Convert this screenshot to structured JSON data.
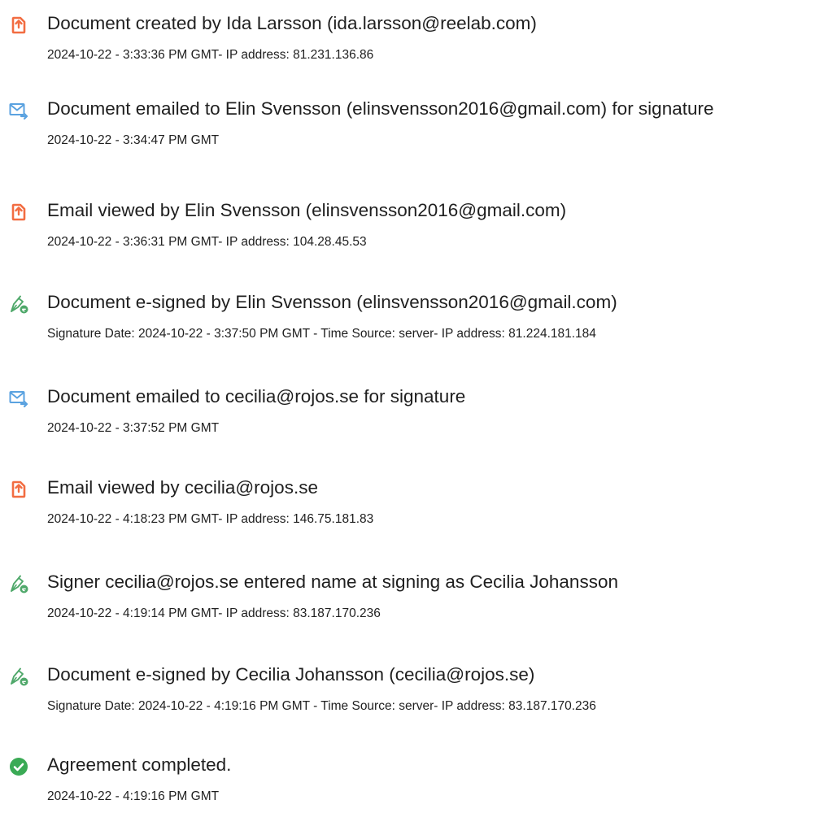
{
  "events": [
    {
      "icon": "document-created-icon",
      "title": "Document created by Ida Larsson (ida.larsson@reelab.com)",
      "meta": "2024-10-22 - 3:33:36 PM GMT- IP address: 81.231.136.86"
    },
    {
      "icon": "email-sent-icon",
      "title": "Document emailed to Elin Svensson (elinsvensson2016@gmail.com) for signature",
      "meta": "2024-10-22 - 3:34:47 PM GMT"
    },
    {
      "icon": "document-viewed-icon",
      "title": "Email viewed by Elin Svensson (elinsvensson2016@gmail.com)",
      "meta": "2024-10-22 - 3:36:31 PM GMT- IP address: 104.28.45.53"
    },
    {
      "icon": "esign-pen-icon",
      "title": "Document e-signed by Elin Svensson (elinsvensson2016@gmail.com)",
      "meta": "Signature Date: 2024-10-22 - 3:37:50 PM GMT - Time Source: server- IP address: 81.224.181.184"
    },
    {
      "icon": "email-sent-icon",
      "title": "Document emailed to cecilia@rojos.se for signature",
      "meta": "2024-10-22 - 3:37:52 PM GMT"
    },
    {
      "icon": "document-viewed-icon",
      "title": "Email viewed by cecilia@rojos.se",
      "meta": "2024-10-22 - 4:18:23 PM GMT- IP address: 146.75.181.83"
    },
    {
      "icon": "esign-pen-icon",
      "title": "Signer cecilia@rojos.se entered name at signing as Cecilia Johansson",
      "meta": "2024-10-22 - 4:19:14 PM GMT- IP address: 83.187.170.236"
    },
    {
      "icon": "esign-pen-icon",
      "title": "Document e-signed by Cecilia Johansson (cecilia@rojos.se)",
      "meta": "Signature Date: 2024-10-22 - 4:19:16 PM GMT - Time Source: server- IP address: 83.187.170.236"
    },
    {
      "icon": "completed-check-icon",
      "title": "Agreement completed.",
      "meta": "2024-10-22 - 4:19:16 PM GMT"
    }
  ],
  "colors": {
    "document_icon": "#f26d42",
    "email_icon": "#5aa2e0",
    "pen_icon": "#4fa86a",
    "check_icon": "#3aaa55",
    "text": "#1f1f1f"
  }
}
